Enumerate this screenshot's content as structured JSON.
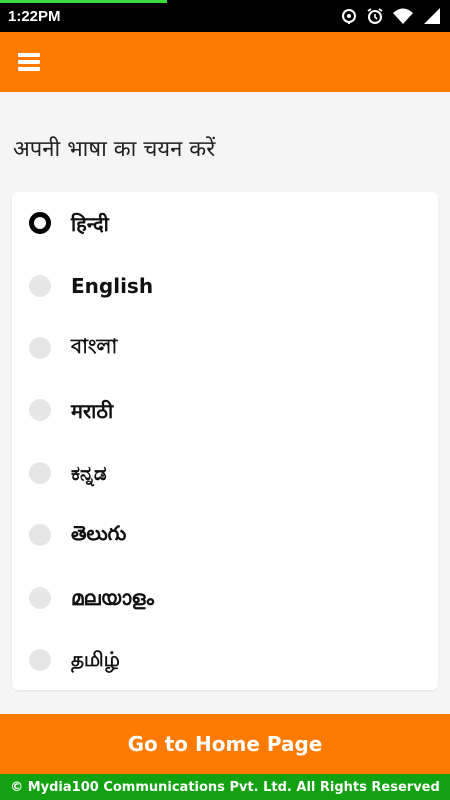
{
  "status_bar": {
    "time": "1:22PM",
    "icons": [
      "sync-icon",
      "alarm-icon",
      "wifi-icon",
      "signal-icon"
    ],
    "progress_fraction": 0.37
  },
  "app_bar": {
    "menu_icon": "hamburger-menu-icon",
    "color": "#ff7a00"
  },
  "heading": "अपनी भाषा का चयन करें",
  "languages": [
    {
      "label": "हिन्दी",
      "selected": true
    },
    {
      "label": "English",
      "selected": false
    },
    {
      "label": "বাংলা",
      "selected": false
    },
    {
      "label": "मराठी",
      "selected": false
    },
    {
      "label": "ಕನ್ನಡ",
      "selected": false
    },
    {
      "label": "తెలుగు",
      "selected": false
    },
    {
      "label": "മലയാളം",
      "selected": false
    },
    {
      "label": "தமிழ்",
      "selected": false
    }
  ],
  "home_button": "Go to Home Page",
  "footer": "© Mydia100 Communications Pvt. Ltd. All Rights Reserved",
  "colors": {
    "accent": "#ff7a00",
    "footer": "#11a111",
    "status_progress": "#3ddc3d"
  }
}
